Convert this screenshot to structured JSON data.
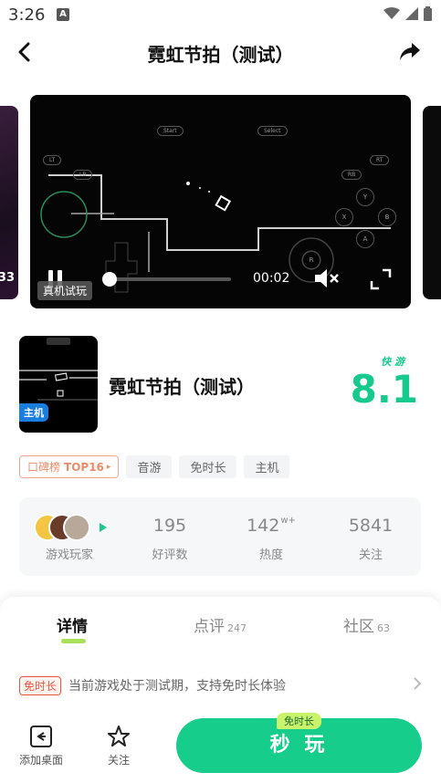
{
  "status": {
    "time": "3:26",
    "notif": "A"
  },
  "header": {
    "title": "霓虹节拍（测试）"
  },
  "carousel": {
    "prev_badge": "33"
  },
  "player": {
    "time": "00:02",
    "badge": "真机试玩",
    "progress": 0.05,
    "labels": {
      "start": "Start",
      "select": "Select",
      "lt": "LT",
      "rt": "RT",
      "lb": "LB",
      "rb": "RB",
      "y": "Y",
      "x": "X",
      "b": "B",
      "a": "A",
      "r": "R"
    }
  },
  "game": {
    "name": "霓虹节拍（测试）",
    "host_badge": "主机",
    "score_source": "快 游",
    "score": "8.1"
  },
  "tags": {
    "rank": "口碑榜",
    "rank_num": "TOP16",
    "items": [
      "音游",
      "免时长",
      "主机"
    ]
  },
  "stats": {
    "players_label": "游戏玩家",
    "reviews": {
      "value": "195",
      "label": "好评数"
    },
    "heat": {
      "value": "142",
      "unit": "w+",
      "label": "热度"
    },
    "follow": {
      "value": "5841",
      "label": "关注"
    }
  },
  "tabs": [
    {
      "label": "详情",
      "count": ""
    },
    {
      "label": "点评",
      "count": "247"
    },
    {
      "label": "社区",
      "count": "63"
    }
  ],
  "notice": {
    "badge": "免时长",
    "text": "当前游戏处于测试期，支持免时长体验"
  },
  "bottom": {
    "desktop": "添加桌面",
    "follow": "关注",
    "play": "秒 玩",
    "free_tag": "免时长"
  },
  "colors": {
    "accent": "#17cd8c",
    "score": "#17c98c",
    "warn": "#e6553d",
    "tab_indicator": "#a8e05a"
  }
}
